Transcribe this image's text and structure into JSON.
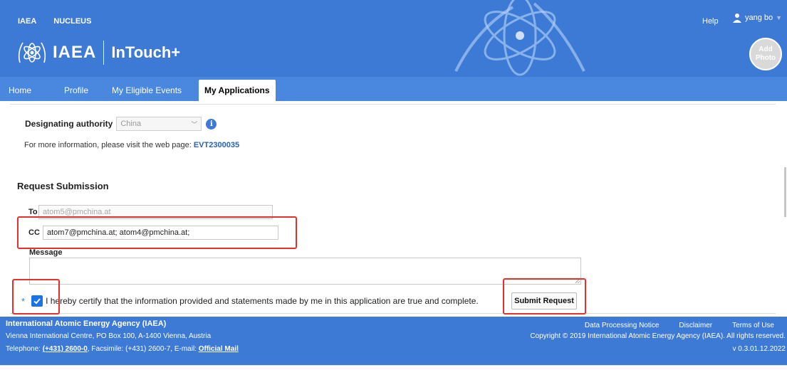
{
  "header": {
    "top_links": [
      "IAEA",
      "NUCLEUS"
    ],
    "help_label": "Help",
    "user_name": "yang bo",
    "brand_iaea": "IAEA",
    "brand_app": "InTouch+",
    "add_photo_line1": "Add",
    "add_photo_line2": "Photo"
  },
  "tabs": [
    {
      "label": "Home"
    },
    {
      "label": "Profile"
    },
    {
      "label": "My Eligible Events"
    },
    {
      "label": "My Applications",
      "active": true
    }
  ],
  "form": {
    "designating_label": "Designating authority",
    "designating_value": "China",
    "more_info_text": "For more information, please visit the web page: ",
    "more_info_link": "EVT2300035",
    "section_title": "Request Submission",
    "to_label": "To",
    "to_value": "atom5@pmchina.at",
    "cc_label": "CC",
    "cc_value": "atom7@pmchina.at; atom4@pmchina.at;",
    "message_label": "Message",
    "message_value": "",
    "required_mark": "*",
    "certify_checked": true,
    "certify_text": "I hereby certify that the information provided and statements made by me in this application are true and complete.",
    "submit_label": "Submit Request"
  },
  "footer": {
    "org": "International Atomic Energy Agency (IAEA)",
    "address": "Vienna International Centre, PO Box 100, A-1400 Vienna, Austria",
    "tel_label": "Telephone: ",
    "tel_value": "(+431) 2600-0",
    "fax_text": ", Facsimile: (+431) 2600-7, E-mail: ",
    "email_link": "Official Mail",
    "links": [
      "Data Processing Notice",
      "Disclaimer",
      "Terms of Use"
    ],
    "copyright": "Copyright © 2019 International Atomic Energy Agency (IAEA). All rights reserved.",
    "version": "v 0.3.01.12.2022"
  },
  "colors": {
    "header_blue": "#3c7ad6",
    "tab_blue": "#4a88df",
    "link_blue": "#2a61b5",
    "highlight_red": "#e8302a",
    "checkbox_blue": "#1a73e8"
  }
}
